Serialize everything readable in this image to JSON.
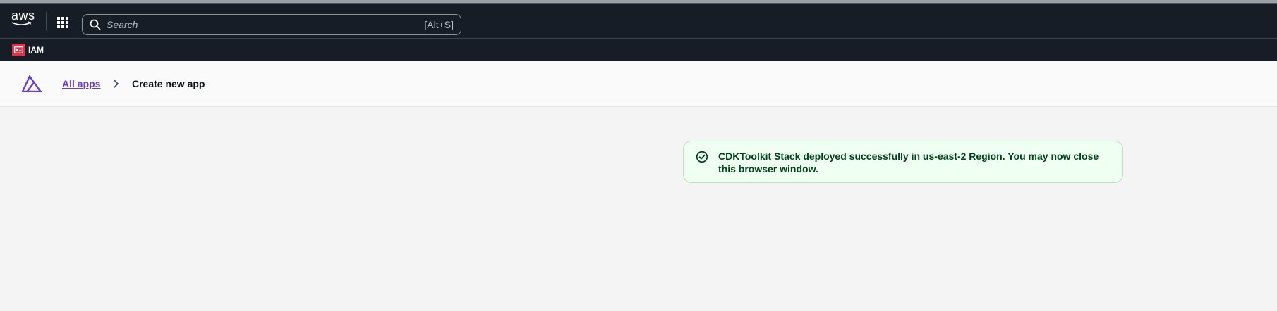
{
  "topbar": {
    "logo_text": "aws",
    "search": {
      "placeholder": "Search",
      "shortcut": "[Alt+S]"
    }
  },
  "service_bar": {
    "favorite_label": "IAM"
  },
  "breadcrumb": {
    "link_label": "All apps",
    "current_label": "Create new app"
  },
  "flash": {
    "type": "success",
    "message": "CDKToolkit Stack deployed successfully in us-east-2 Region. You may now close this browser window."
  },
  "colors": {
    "header_bg": "#161d26",
    "page_bg": "#f4f4f4",
    "link": "#6b40c4",
    "success_bg": "#effff1",
    "success_text": "#00441b",
    "iam_icon": "#dd344c"
  },
  "icons": [
    "aws-logo",
    "apps-grid-icon",
    "search-icon",
    "iam-service-icon",
    "amplify-logo-icon",
    "chevron-right-icon",
    "success-check-icon"
  ]
}
